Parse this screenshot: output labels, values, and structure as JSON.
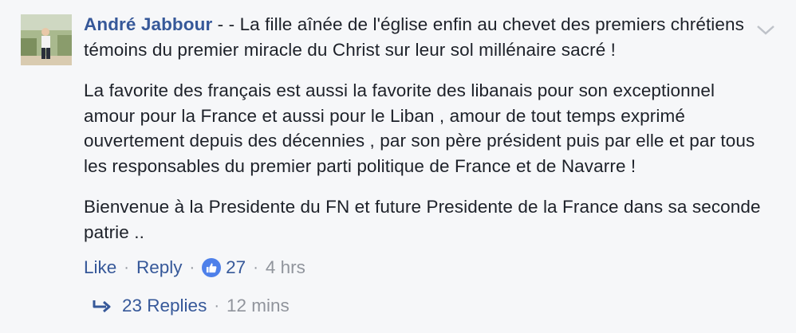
{
  "comment": {
    "author": "André Jabbour",
    "first_line_rest": " - - La fille aînée de l'église enfin au chevet des premiers chrétiens témoins du premier miracle du Christ sur leur sol millénaire sacré !",
    "paragraph_2": "La favorite des français est aussi la favorite des libanais pour son exceptionnel amour pour la France et aussi pour le Liban , amour de tout temps exprimé ouvertement depuis des décennies , par son père président puis par elle et par tous les responsables du premier parti politique de France et de Navarre !",
    "paragraph_3": "Bienvenue à la Presidente du FN et future Presidente de la France dans sa seconde patrie .."
  },
  "actions": {
    "like_label": "Like",
    "separator": "·",
    "reply_label": "Reply",
    "reaction_count": "27",
    "time": "4 hrs"
  },
  "replies": {
    "label": "23 Replies",
    "separator": "·",
    "time": "12 mins"
  },
  "colors": {
    "link": "#365899",
    "meta": "#90949c",
    "like_badge": "#4e80ea",
    "background": "#f6f7f9"
  },
  "icons": {
    "options": "chevron-down-icon",
    "like_badge": "thumbs-up-icon",
    "reply": "reply-arrow-icon"
  }
}
